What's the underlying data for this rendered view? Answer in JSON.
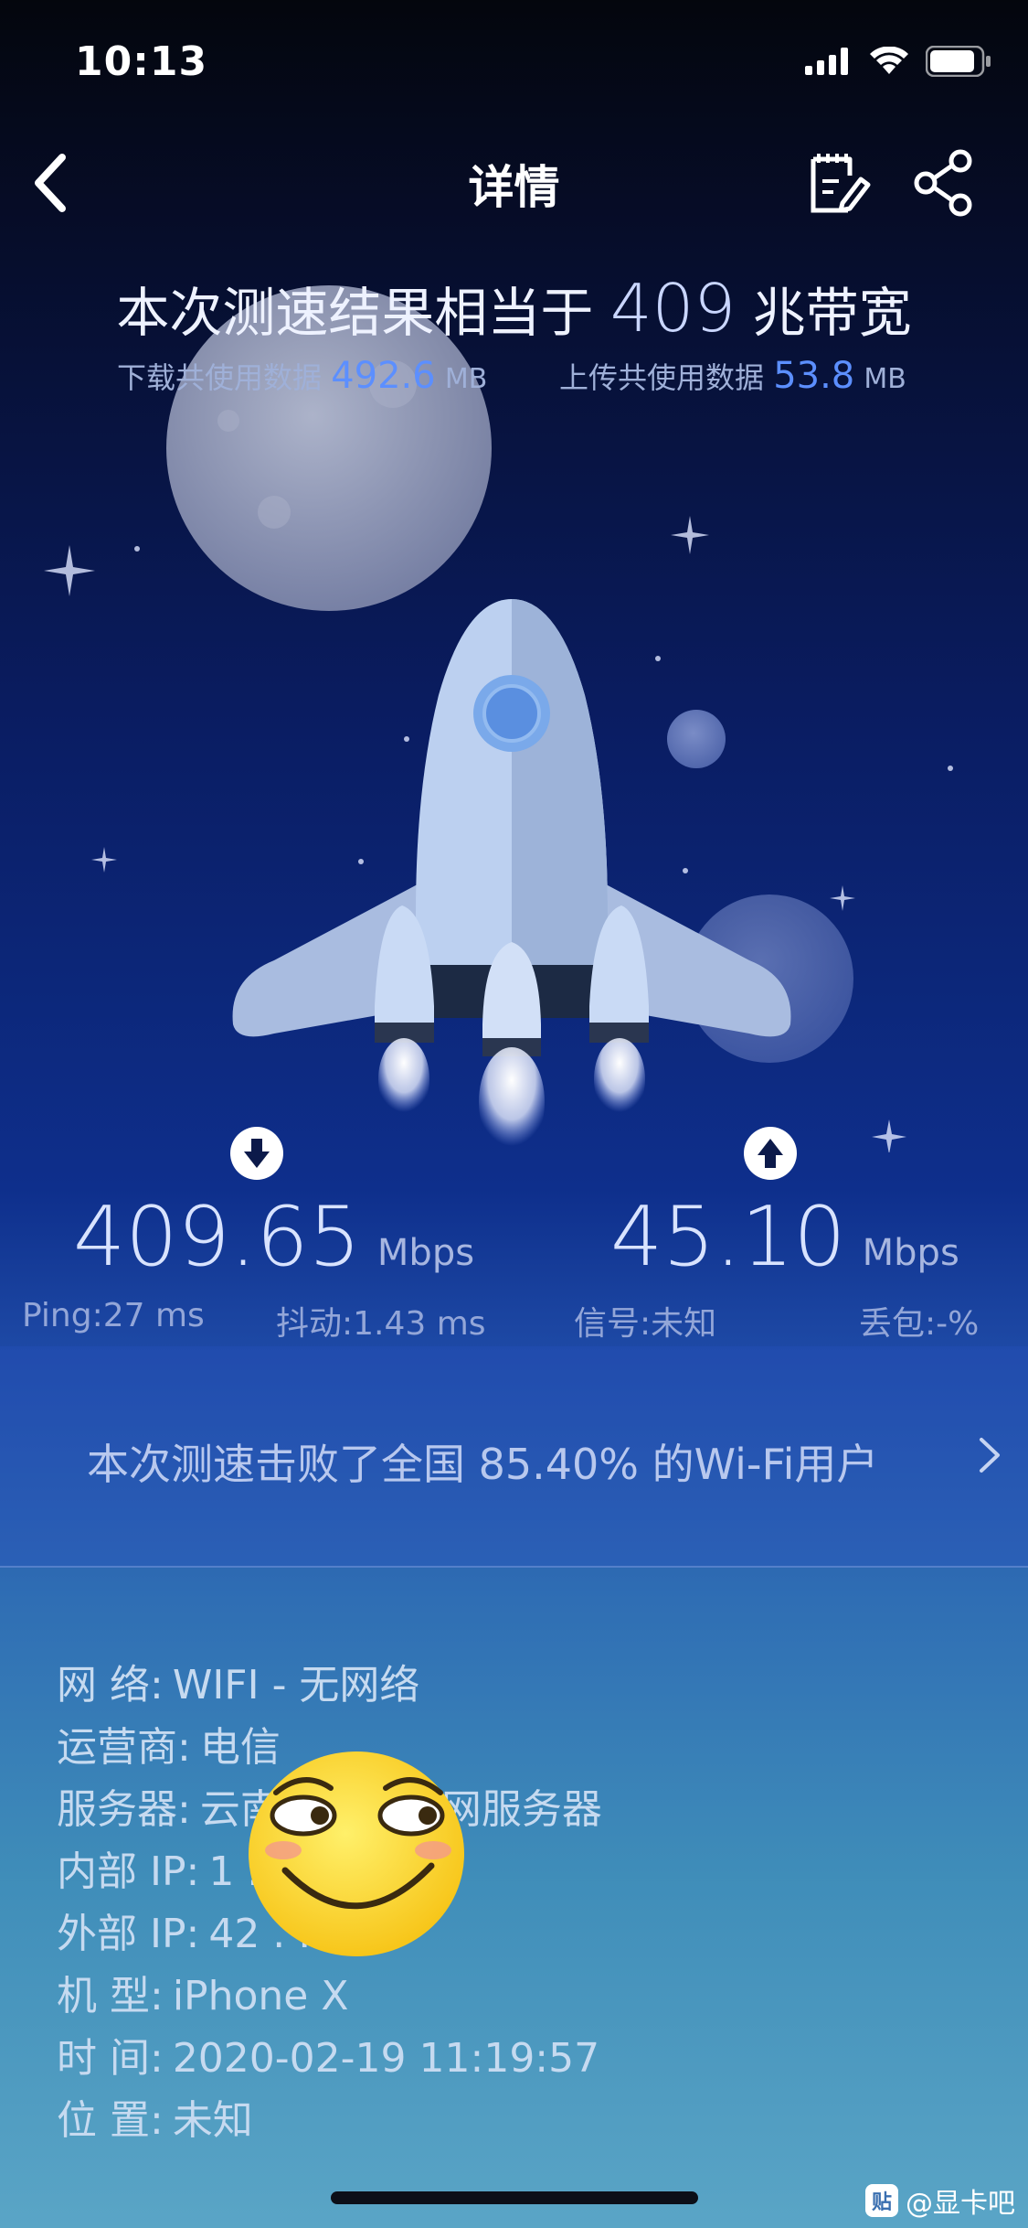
{
  "status_bar": {
    "time": "10:13"
  },
  "nav": {
    "title": "详情"
  },
  "summary": {
    "headline_prefix": "本次测速结果相当于",
    "headline_value": "409",
    "headline_suffix": "兆带宽",
    "download_label": "下载共使用数据",
    "download_value": "492.6",
    "download_unit": "MB",
    "upload_label": "上传共使用数据",
    "upload_value": "53.8",
    "upload_unit": "MB"
  },
  "speeds": {
    "download": {
      "value": "409.65",
      "unit": "Mbps",
      "icon": "arrow-down-icon"
    },
    "upload": {
      "value": "45.10",
      "unit": "Mbps",
      "icon": "arrow-up-icon"
    }
  },
  "stats": {
    "ping": "Ping:27 ms",
    "jitter": "抖动:1.43 ms",
    "signal": "信号:未知",
    "packet_loss": "丢包:-%"
  },
  "rank": {
    "text": "本次测速击败了全国 85.40% 的Wi-Fi用户"
  },
  "details": [
    {
      "key": "网 络:",
      "value": "WIFI - 无网络"
    },
    {
      "key": "运营商:",
      "value": "电信"
    },
    {
      "key": "服务器:",
      "value": "云南电信互联网服务器"
    },
    {
      "key": "内部 IP:",
      "value": "1   .   .   .248"
    },
    {
      "key": "外部 IP:",
      "value": "42   .   .3.49"
    },
    {
      "key": "机 型:",
      "value": "iPhone X"
    },
    {
      "key": "时 间:",
      "value": "2020-02-19 11:19:57"
    },
    {
      "key": "位 置:",
      "value": "未知"
    }
  ],
  "watermark": {
    "badge": "贴",
    "text": "@显卡吧"
  },
  "colors": {
    "accent_blue": "#5c8fff",
    "bg_top": "#04060d",
    "bg_bottom": "#5aa5c6"
  }
}
